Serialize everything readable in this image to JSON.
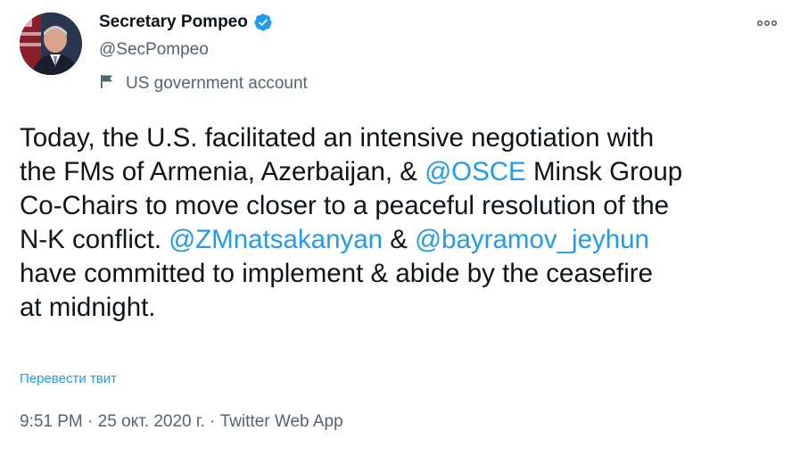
{
  "author": {
    "display_name": "Secretary Pompeo",
    "handle": "@SecPompeo",
    "label": "US government account"
  },
  "tweet": {
    "line1": "Today, the U.S. facilitated an intensive negotiation with",
    "line2_a": "the FMs of Armenia, Azerbaijan, & ",
    "line2_mention": "@OSCE",
    "line2_b": " Minsk Group",
    "line3": "Co-Chairs to move closer to a peaceful resolution of the",
    "line4_a": "N-K conflict. ",
    "line4_mention1": "@ZMnatsakanyan",
    "line4_b": " & ",
    "line4_mention2": "@bayramov_jeyhun",
    "line5": "have committed to implement & abide by the ceasefire",
    "line6": "at midnight."
  },
  "translate_label": "Перевести твит",
  "meta": {
    "time": "9:51 PM",
    "sep1": " · ",
    "date": "25 окт. 2020 г.",
    "sep2": " · ",
    "source": "Twitter Web App"
  },
  "icons": {
    "verified": "verified-badge-icon",
    "more": "more-options-icon",
    "flag": "flag-icon"
  },
  "colors": {
    "link": "#1d9bf0",
    "secondary": "#536471",
    "text": "#0f1419"
  }
}
